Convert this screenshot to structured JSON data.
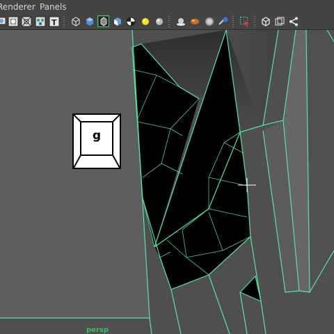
{
  "menubar": {
    "items": [
      {
        "label": "Renderer"
      },
      {
        "label": "Panels"
      }
    ]
  },
  "toolbar": {
    "buttons": [
      {
        "name": "select-camera-icon"
      },
      {
        "name": "camera-attributes-icon"
      },
      {
        "name": "grid-icon"
      },
      {
        "name": "film-gate-icon"
      },
      {
        "name": "text-label-icon"
      },
      {
        "name": "wireframe-cube-icon"
      },
      {
        "name": "smooth-shade-icon"
      },
      {
        "name": "wireframe-on-shaded-icon"
      },
      {
        "name": "textured-icon"
      },
      {
        "name": "checker-icon"
      },
      {
        "name": "default-light-icon"
      },
      {
        "name": "all-lights-icon"
      },
      {
        "name": "shadows-icon"
      },
      {
        "name": "material-icon"
      },
      {
        "name": "ambient-occlusion-icon"
      },
      {
        "name": "motion-blur-icon"
      },
      {
        "name": "isolate-select-icon"
      },
      {
        "name": "xray-icon"
      },
      {
        "name": "xray-joints-icon"
      },
      {
        "name": "xray-components-icon"
      }
    ]
  },
  "viewport": {
    "key_hint": "g",
    "camera_label": "persp",
    "wire_color": "#52e8a4",
    "background_color": "#595959"
  }
}
